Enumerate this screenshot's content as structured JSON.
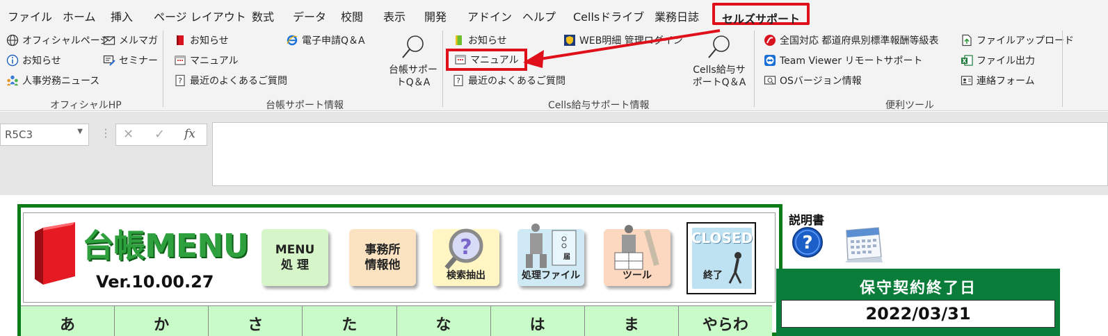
{
  "tabs": [
    "ファイル",
    "ホーム",
    "挿入",
    "ページ レイアウト",
    "数式",
    "データ",
    "校閲",
    "表示",
    "開発",
    "アドイン",
    "ヘルプ",
    "Cellsドライブ",
    "業務日誌",
    "セルズサポート"
  ],
  "ribbon": {
    "official": {
      "items": [
        "オフィシャルページ",
        "お知らせ",
        "人事労務ニュース",
        "メルマガ",
        "セミナー"
      ],
      "label": "オフィシャルHP"
    },
    "daicho": {
      "items": [
        "お知らせ",
        "マニュアル",
        "最近のよくあるご質問",
        "電子申請Q＆A"
      ],
      "big_button": [
        "台帳サポー",
        "トQ＆A"
      ],
      "label": "台帳サポート情報"
    },
    "cells": {
      "items": [
        "お知らせ",
        "マニュアル",
        "最近のよくあるご質問",
        "WEB明細 管理ログイン"
      ],
      "big_button": [
        "Cells給与サ",
        "ポートQ＆A"
      ],
      "label": "Cells給与サポート情報"
    },
    "tools": {
      "items": [
        "全国対応 都道府県別標準報酬等級表",
        "Team Viewer リモートサポート",
        "OSバージョン情報",
        "ファイルアップロード",
        "ファイル出力",
        "連絡フォーム"
      ],
      "label": "便利ツール"
    }
  },
  "formula_bar": {
    "name_box": "R5C3",
    "cancel": "✕",
    "enter": "✓",
    "fx": "fx"
  },
  "sheet": {
    "title": "台帳MENU",
    "version": "Ver.10.00.27",
    "buttons": [
      {
        "line1": "MENU",
        "line2": "処 理"
      },
      {
        "line1": "事務所",
        "line2": "情報他"
      },
      {
        "label": "検索抽出"
      },
      {
        "label": "処理ファイル",
        "small": "届"
      },
      {
        "label": "ツール"
      },
      {
        "line1": "CLOSED",
        "line2": "終了"
      }
    ],
    "kana": [
      "あ",
      "か",
      "さ",
      "た",
      "な",
      "は",
      "ま",
      "やらわ"
    ],
    "manual_label": "説明書",
    "contract_title": "保守契約終了日",
    "contract_date": "2022/03/31"
  },
  "colors": {
    "highlight": "#e0101b",
    "menu_green": "#0b7d18",
    "kana_bg": "#c8fbc8"
  }
}
